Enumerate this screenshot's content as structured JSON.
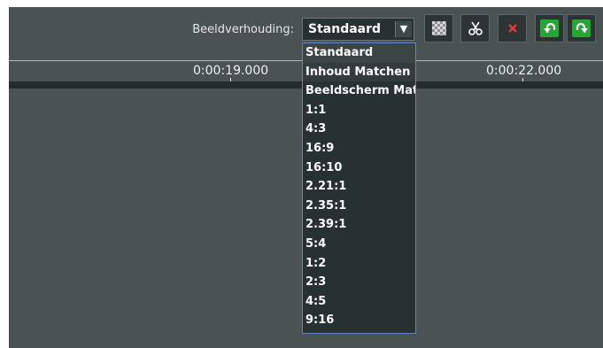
{
  "toolbar": {
    "ratio_label": "Beeldverhouding:",
    "ratio_selected": "Standaard",
    "buttons": [
      {
        "name": "transparency-button",
        "icon": "checkerboard-icon"
      },
      {
        "name": "cut-button",
        "icon": "scissors-icon"
      },
      {
        "name": "delete-button",
        "icon": "close-icon"
      },
      {
        "name": "undo-button",
        "icon": "undo-arrow-icon"
      },
      {
        "name": "redo-button",
        "icon": "redo-arrow-icon"
      }
    ]
  },
  "timeline": {
    "time_left": "0:00:19.000",
    "time_right": "0:00:22.000"
  },
  "dropdown": {
    "options": [
      "Standaard",
      "Inhoud Matchen",
      "Beeldscherm Mat...",
      "1:1",
      "4:3",
      "16:9",
      "16:10",
      "2.21:1",
      "2.35:1",
      "2.39:1",
      "5:4",
      "1:2",
      "2:3",
      "4:5",
      "9:16"
    ]
  },
  "colors": {
    "panel": "#4b5253",
    "dark": "#283131",
    "accent_border": "#5e86c4",
    "green": "#27a635",
    "red": "#ce2d2d"
  }
}
